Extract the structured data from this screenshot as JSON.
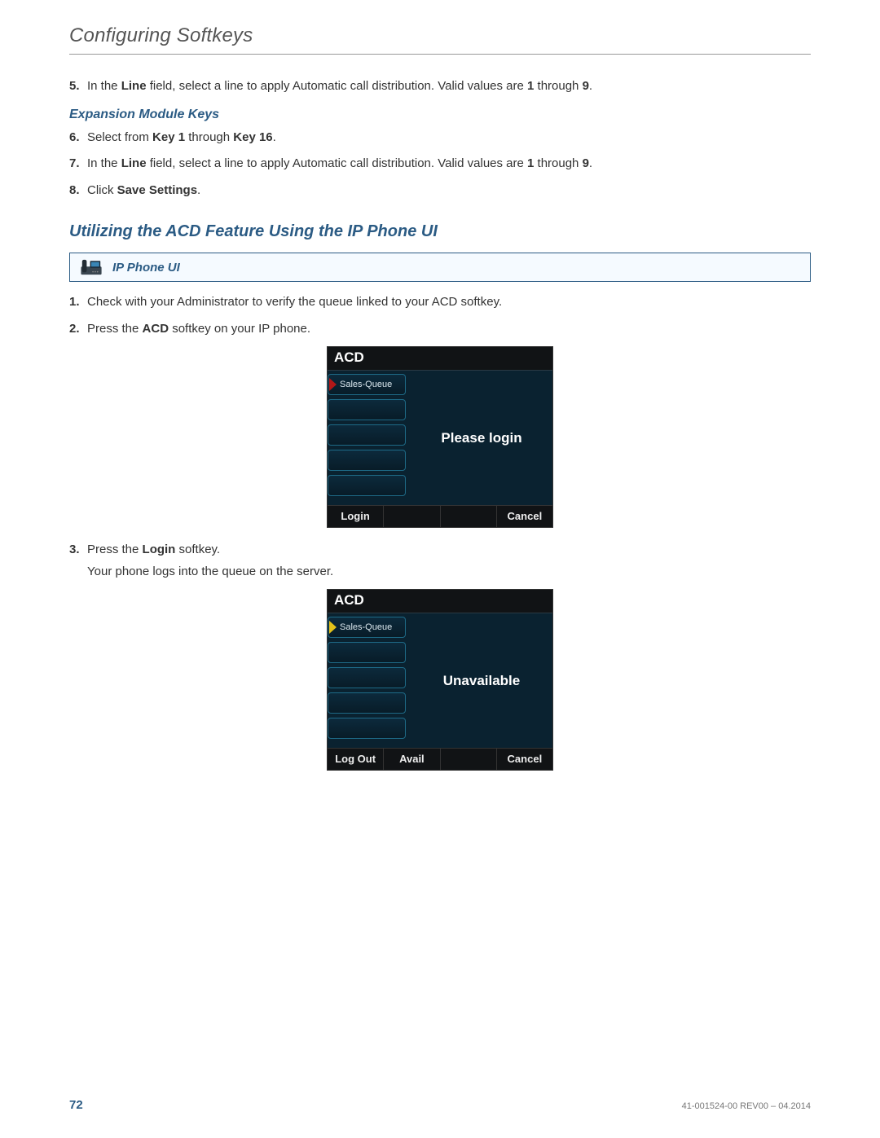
{
  "header": {
    "title": "Configuring Softkeys"
  },
  "steps_a": [
    {
      "n": "5.",
      "pre": "In the ",
      "b1": "Line",
      "mid": " field, select a line to apply Automatic call distribution. Valid values are ",
      "b2": "1",
      "mid2": " through ",
      "b3": "9",
      "post": "."
    }
  ],
  "exp_heading": "Expansion Module Keys",
  "steps_b": [
    {
      "n": "6.",
      "pre": "Select from ",
      "b1": "Key 1",
      "mid": " through ",
      "b2": "Key 16",
      "post": "."
    },
    {
      "n": "7.",
      "pre": "In the ",
      "b1": "Line",
      "mid": " field, select a line to apply Automatic call distribution. Valid values are ",
      "b2": "1",
      "mid2": " through ",
      "b3": "9",
      "post": "."
    },
    {
      "n": "8.",
      "pre": "Click ",
      "b1": "Save Settings",
      "post": "."
    }
  ],
  "section_heading": "Utilizing the ACD Feature  Using the IP Phone UI",
  "callout": {
    "label": "IP Phone UI"
  },
  "steps_c": [
    {
      "n": "1.",
      "text": "Check with your Administrator to verify the queue linked to your ACD softkey."
    },
    {
      "n": "2.",
      "pre": "Press the ",
      "b1": "ACD",
      "post": " softkey on your IP phone."
    }
  ],
  "screen1": {
    "title": "ACD",
    "sidekey_label": "Sales-Queue",
    "marker": "red",
    "main": "Please login",
    "softkeys": [
      "Login",
      "",
      "",
      "Cancel"
    ]
  },
  "step3": {
    "n": "3.",
    "pre": "Press the ",
    "b1": "Login",
    "post": " softkey."
  },
  "step3_sub": "Your phone logs into the queue on the server.",
  "screen2": {
    "title": "ACD",
    "sidekey_label": "Sales-Queue",
    "marker": "yellow",
    "main": "Unavailable",
    "softkeys": [
      "Log Out",
      "Avail",
      "",
      "Cancel"
    ]
  },
  "footer": {
    "page": "72",
    "doc": "41-001524-00 REV00 – 04.2014"
  }
}
